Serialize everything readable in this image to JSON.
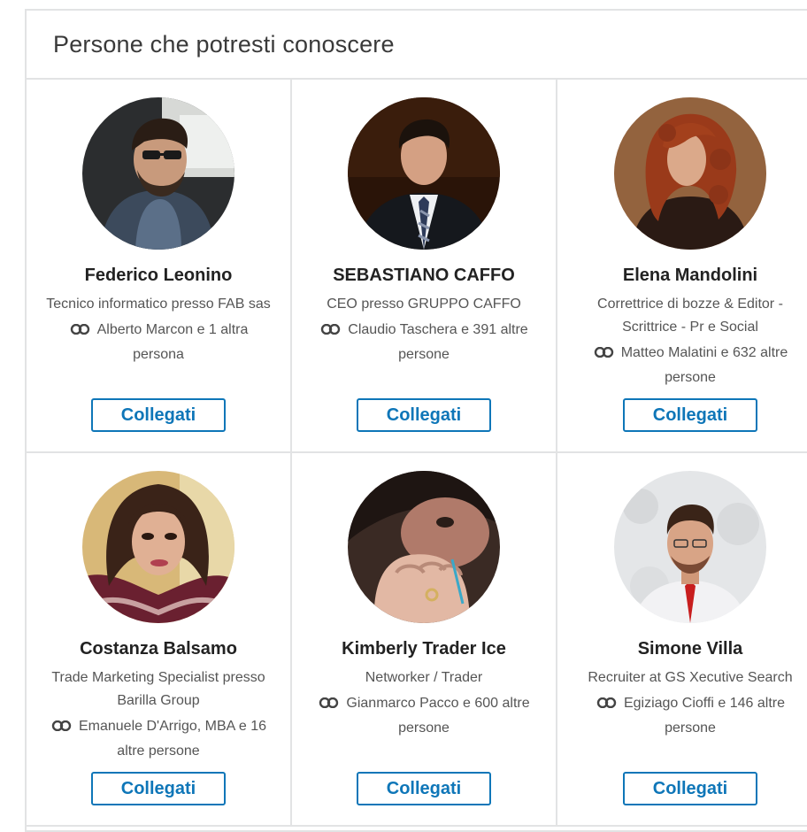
{
  "panel": {
    "title": "Persone che potresti conoscere"
  },
  "people": [
    {
      "name": "Federico Leonino",
      "headline": "Tecnico informatico presso FAB sas",
      "connections": "Alberto Marcon e 1 altra persona",
      "button_label": "Collegati",
      "avatar": "man-glasses-car-photo"
    },
    {
      "name": "SEBASTIANO CAFFO",
      "headline": "CEO presso GRUPPO CAFFO",
      "connections": "Claudio Taschera e 391 altre persone",
      "button_label": "Collegati",
      "avatar": "man-suit-tie-photo"
    },
    {
      "name": "Elena Mandolini",
      "headline": "Correttrice di bozze & Editor - Scrittrice - Pr e Social",
      "connections": "Matteo Malatini e 632 altre persone",
      "button_label": "Collegati",
      "avatar": "woman-curly-red-hair-photo"
    },
    {
      "name": "Costanza Balsamo",
      "headline": "Trade Marketing Specialist presso Barilla Group",
      "connections": "Emanuele D'Arrigo, MBA e 16 altre persone",
      "button_label": "Collegati",
      "avatar": "woman-selfie-photo"
    },
    {
      "name": "Kimberly Trader Ice",
      "headline": "Networker / Trader",
      "connections": "Gianmarco Pacco e 600 altre persone",
      "button_label": "Collegati",
      "avatar": "face-behind-hand-photo"
    },
    {
      "name": "Simone Villa",
      "headline": "Recruiter at GS Xecutive Search",
      "connections": "Egiziago Cioffi e 146 altre persone",
      "button_label": "Collegati",
      "avatar": "man-red-tie-photo"
    }
  ],
  "icons": {
    "shared_connections": "shared-connections-icon"
  },
  "colors": {
    "accent": "#0e76b8",
    "border": "#e2e3e4",
    "name_text": "#222222",
    "secondary_text": "#555555"
  }
}
